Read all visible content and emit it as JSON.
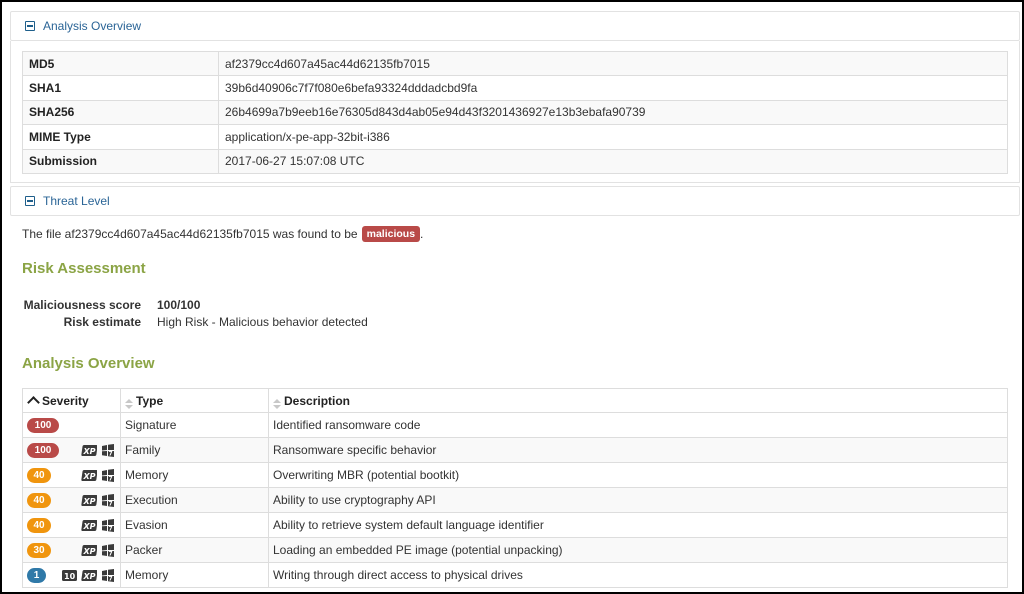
{
  "overview_panel": {
    "title": "Analysis Overview",
    "rows": [
      {
        "label": "MD5",
        "value": "af2379cc4d607a45ac44d62135fb7015"
      },
      {
        "label": "SHA1",
        "value": "39b6d40906c7f7f080e6befa93324dddadcbd9fa"
      },
      {
        "label": "SHA256",
        "value": "26b4699a7b9eeb16e76305d843d4ab05e94d43f3201436927e13b3ebafa90739"
      },
      {
        "label": "MIME Type",
        "value": "application/x-pe-app-32bit-i386"
      },
      {
        "label": "Submission",
        "value": "2017-06-27 15:07:08 UTC"
      }
    ]
  },
  "threat_panel": {
    "title": "Threat Level",
    "sentence_prefix": "The file af2379cc4d607a45ac44d62135fb7015 was found to be",
    "verdict": "malicious",
    "sentence_suffix": "."
  },
  "risk": {
    "heading": "Risk Assessment",
    "items": [
      {
        "label": "Maliciousness score",
        "value": "100/100"
      },
      {
        "label": "Risk estimate",
        "value": "High Risk - Malicious behavior detected"
      }
    ]
  },
  "analysis": {
    "heading": "Analysis Overview",
    "columns": {
      "severity": "Severity",
      "type": "Type",
      "description": "Description"
    },
    "rows": [
      {
        "severity": "100",
        "level": "high",
        "type": "Signature",
        "description": "Identified ransomware code",
        "icons": []
      },
      {
        "severity": "100",
        "level": "high",
        "type": "Family",
        "description": "Ransomware specific behavior",
        "icons": [
          "windows-xp-icon",
          "windows-7-icon"
        ]
      },
      {
        "severity": "40",
        "level": "medium",
        "type": "Memory",
        "description": "Overwriting MBR (potential bootkit)",
        "icons": [
          "windows-xp-icon",
          "windows-7-icon"
        ]
      },
      {
        "severity": "40",
        "level": "medium",
        "type": "Execution",
        "description": "Ability to use cryptography API",
        "icons": [
          "windows-xp-icon",
          "windows-7-icon"
        ]
      },
      {
        "severity": "40",
        "level": "medium",
        "type": "Evasion",
        "description": "Ability to retrieve system default language identifier",
        "icons": [
          "windows-xp-icon",
          "windows-7-icon"
        ]
      },
      {
        "severity": "30",
        "level": "medium",
        "type": "Packer",
        "description": "Loading an embedded PE image (potential unpacking)",
        "icons": [
          "windows-xp-icon",
          "windows-7-icon"
        ]
      },
      {
        "severity": "1",
        "level": "low",
        "type": "Memory",
        "description": "Writing through direct access to physical drives",
        "icons": [
          "windows-10-icon",
          "windows-xp-icon",
          "windows-7-icon"
        ]
      }
    ]
  },
  "colors": {
    "link": "#2a6496",
    "section_heading": "#8ba445",
    "badge_high": "#b94a48",
    "badge_medium": "#f0950e",
    "badge_low": "#2f79a8"
  }
}
